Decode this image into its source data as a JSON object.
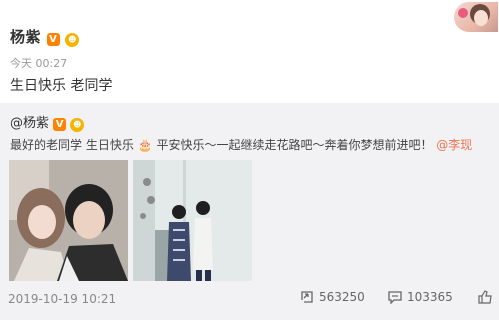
{
  "post": {
    "author": "杨紫",
    "v_badge": "V",
    "vip_badge": "☻",
    "time": "今天 00:27",
    "text": "生日快乐 老同学"
  },
  "repost": {
    "author": "@杨紫",
    "text_main": "最好的老同学 生日快乐",
    "cake_emoji": "🎂",
    "text_rest": " 平安快乐～一起继续走花路吧～奔着你梦想前进吧！",
    "mention": "@李现"
  },
  "footer": {
    "date": "2019-10-19 10:21",
    "repost_count": "563250",
    "comment_count": "103365"
  },
  "colors": {
    "accent": "#ff8200",
    "mention": "#eb7350",
    "repost_bg": "#f2f2f5"
  },
  "icons": [
    "v-verified-icon",
    "vip-icon",
    "repost-icon",
    "comment-icon",
    "like-icon"
  ]
}
